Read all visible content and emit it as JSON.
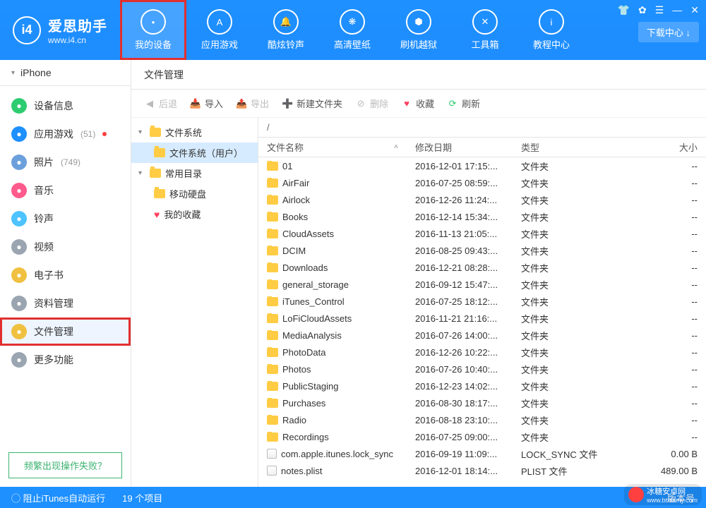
{
  "brand": {
    "name": "爱思助手",
    "site": "www.i4.cn",
    "logo_text": "i4"
  },
  "header": {
    "nav": [
      {
        "label": "我的设备",
        "icon": "apple"
      },
      {
        "label": "应用游戏",
        "icon": "appstore"
      },
      {
        "label": "酷炫铃声",
        "icon": "bell"
      },
      {
        "label": "高清壁纸",
        "icon": "flower"
      },
      {
        "label": "刷机越狱",
        "icon": "box"
      },
      {
        "label": "工具箱",
        "icon": "wrench"
      },
      {
        "label": "教程中心",
        "icon": "info"
      }
    ],
    "download_center": "下载中心 ↓"
  },
  "sidebar": {
    "device": "iPhone",
    "items": [
      {
        "label": "设备信息",
        "color": "#2ecc71",
        "count": ""
      },
      {
        "label": "应用游戏",
        "color": "#1e90ff",
        "count": "(51)",
        "dot": true
      },
      {
        "label": "照片",
        "color": "#6ca0dc",
        "count": "(749)"
      },
      {
        "label": "音乐",
        "color": "#ff5a8c",
        "count": ""
      },
      {
        "label": "铃声",
        "color": "#4dc3ff",
        "count": ""
      },
      {
        "label": "视频",
        "color": "#9aa5b1",
        "count": ""
      },
      {
        "label": "电子书",
        "color": "#f0c040",
        "count": ""
      },
      {
        "label": "资料管理",
        "color": "#9aa5b1",
        "count": ""
      },
      {
        "label": "文件管理",
        "color": "#f0c040",
        "count": ""
      },
      {
        "label": "更多功能",
        "color": "#9aa5b1",
        "count": ""
      }
    ],
    "help": "频繁出现操作失败？"
  },
  "tab": {
    "label": "文件管理"
  },
  "toolbar": {
    "back": "后退",
    "import": "导入",
    "export": "导出",
    "newfolder": "新建文件夹",
    "delete": "删除",
    "favorite": "收藏",
    "refresh": "刷新"
  },
  "tree": {
    "root": "文件系统",
    "user_fs": "文件系统（用户）",
    "common": "常用目录",
    "mobile_disk": "移动硬盘",
    "favorites": "我的收藏"
  },
  "path": "/",
  "columns": {
    "name": "文件名称",
    "date": "修改日期",
    "type": "类型",
    "size": "大小"
  },
  "files": [
    {
      "name": "01",
      "date": "2016-12-01 17:15:...",
      "type": "文件夹",
      "size": "--",
      "kind": "folder"
    },
    {
      "name": "AirFair",
      "date": "2016-07-25 08:59:...",
      "type": "文件夹",
      "size": "--",
      "kind": "folder"
    },
    {
      "name": "Airlock",
      "date": "2016-12-26 11:24:...",
      "type": "文件夹",
      "size": "--",
      "kind": "folder"
    },
    {
      "name": "Books",
      "date": "2016-12-14 15:34:...",
      "type": "文件夹",
      "size": "--",
      "kind": "folder"
    },
    {
      "name": "CloudAssets",
      "date": "2016-11-13 21:05:...",
      "type": "文件夹",
      "size": "--",
      "kind": "folder"
    },
    {
      "name": "DCIM",
      "date": "2016-08-25 09:43:...",
      "type": "文件夹",
      "size": "--",
      "kind": "folder"
    },
    {
      "name": "Downloads",
      "date": "2016-12-21 08:28:...",
      "type": "文件夹",
      "size": "--",
      "kind": "folder"
    },
    {
      "name": "general_storage",
      "date": "2016-09-12 15:47:...",
      "type": "文件夹",
      "size": "--",
      "kind": "folder"
    },
    {
      "name": "iTunes_Control",
      "date": "2016-07-25 18:12:...",
      "type": "文件夹",
      "size": "--",
      "kind": "folder"
    },
    {
      "name": "LoFiCloudAssets",
      "date": "2016-11-21 21:16:...",
      "type": "文件夹",
      "size": "--",
      "kind": "folder"
    },
    {
      "name": "MediaAnalysis",
      "date": "2016-07-26 14:00:...",
      "type": "文件夹",
      "size": "--",
      "kind": "folder"
    },
    {
      "name": "PhotoData",
      "date": "2016-12-26 10:22:...",
      "type": "文件夹",
      "size": "--",
      "kind": "folder"
    },
    {
      "name": "Photos",
      "date": "2016-07-26 10:40:...",
      "type": "文件夹",
      "size": "--",
      "kind": "folder"
    },
    {
      "name": "PublicStaging",
      "date": "2016-12-23 14:02:...",
      "type": "文件夹",
      "size": "--",
      "kind": "folder"
    },
    {
      "name": "Purchases",
      "date": "2016-08-30 18:17:...",
      "type": "文件夹",
      "size": "--",
      "kind": "folder"
    },
    {
      "name": "Radio",
      "date": "2016-08-18 23:10:...",
      "type": "文件夹",
      "size": "--",
      "kind": "folder"
    },
    {
      "name": "Recordings",
      "date": "2016-07-25 09:00:...",
      "type": "文件夹",
      "size": "--",
      "kind": "folder"
    },
    {
      "name": "com.apple.itunes.lock_sync",
      "date": "2016-09-19 11:09:...",
      "type": "LOCK_SYNC 文件",
      "size": "0.00 B",
      "kind": "file"
    },
    {
      "name": "notes.plist",
      "date": "2016-12-01 18:14:...",
      "type": "PLIST 文件",
      "size": "489.00 B",
      "kind": "file"
    }
  ],
  "status": {
    "itunes": "阻止iTunes自动运行",
    "count": "19 个项目",
    "version": "版本号"
  },
  "watermark": {
    "line1": "冰糖安卓网",
    "line2": "www.btxtdmy.com"
  }
}
